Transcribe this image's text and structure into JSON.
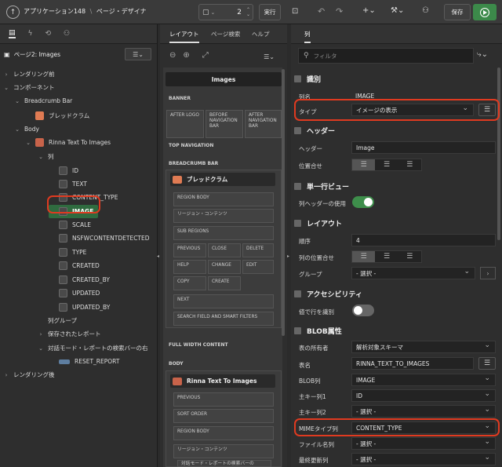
{
  "topbar": {
    "app_title": "アプリケーション148",
    "separator": "\\",
    "page_title": "ページ・デザイナ",
    "page_number": "2",
    "run_label": "実行",
    "save_label": "保存"
  },
  "left": {
    "root_label": "ページ2: Images",
    "tree": [
      {
        "label": "レンダリング前",
        "depth": 0,
        "chev": "›",
        "icon": "none"
      },
      {
        "label": "コンポーネント",
        "depth": 0,
        "chev": "⌄",
        "icon": "none"
      },
      {
        "label": "Breadcrumb Bar",
        "depth": 1,
        "chev": "⌄",
        "icon": "none"
      },
      {
        "label": "ブレッドクラム",
        "depth": 2,
        "chev": "",
        "icon": "breadcrumb"
      },
      {
        "label": "Body",
        "depth": 1,
        "chev": "⌄",
        "icon": "none"
      },
      {
        "label": "Rinna Text To Images",
        "depth": 2,
        "chev": "⌄",
        "icon": "report"
      },
      {
        "label": "列",
        "depth": 3,
        "chev": "⌄",
        "icon": "none"
      },
      {
        "label": "ID",
        "depth": 4,
        "chev": "",
        "icon": "column"
      },
      {
        "label": "TEXT",
        "depth": 4,
        "chev": "",
        "icon": "column"
      },
      {
        "label": "CONTENT_TYPE",
        "depth": 4,
        "chev": "",
        "icon": "column"
      },
      {
        "label": "IMAGE",
        "depth": 4,
        "chev": "",
        "icon": "image"
      },
      {
        "label": "SCALE",
        "depth": 4,
        "chev": "",
        "icon": "column"
      },
      {
        "label": "NSFWCONTENTDETECTED",
        "depth": 4,
        "chev": "",
        "icon": "column"
      },
      {
        "label": "TYPE",
        "depth": 4,
        "chev": "",
        "icon": "column"
      },
      {
        "label": "CREATED",
        "depth": 4,
        "chev": "",
        "icon": "column"
      },
      {
        "label": "CREATED_BY",
        "depth": 4,
        "chev": "",
        "icon": "column"
      },
      {
        "label": "UPDATED",
        "depth": 4,
        "chev": "",
        "icon": "column"
      },
      {
        "label": "UPDATED_BY",
        "depth": 4,
        "chev": "",
        "icon": "column"
      },
      {
        "label": "列グループ",
        "depth": 3,
        "chev": "",
        "icon": "none"
      },
      {
        "label": "保存されたレポート",
        "depth": 3,
        "chev": "›",
        "icon": "none"
      },
      {
        "label": "対話モード・レポートの検索バーの右",
        "depth": 3,
        "chev": "⌄",
        "icon": "none"
      },
      {
        "label": "RESET_REPORT",
        "depth": 4,
        "chev": "",
        "icon": "button"
      },
      {
        "label": "レンダリング後",
        "depth": 0,
        "chev": "›",
        "icon": "none"
      }
    ]
  },
  "middle": {
    "tabs": [
      "レイアウト",
      "ページ検索",
      "ヘルプ"
    ],
    "page_header": "Images",
    "banner": "BANNER",
    "after_logo": "AFTER LOGO",
    "before_nav": "BEFORE NAVIGATION BAR",
    "after_nav": "AFTER NAVIGATION BAR",
    "top_navigation": "TOP NAVIGATION",
    "breadcrumb_bar": "BREADCRUMB BAR",
    "breadcrumb_region": "ブレッドクラム",
    "slots": [
      "REGION BODY",
      "リージョン・コンテンツ",
      "SUB REGIONS"
    ],
    "buttons": [
      "PREVIOUS",
      "CLOSE",
      "DELETE",
      "HELP",
      "CHANGE",
      "EDIT",
      "COPY",
      "CREATE"
    ],
    "next": "NEXT",
    "search_field": "SEARCH FIELD AND SMART FILTERS",
    "full_width": "FULL WIDTH CONTENT",
    "body": "BODY",
    "report_region": "Rinna Text To Images",
    "body_slots": [
      "PREVIOUS",
      "SORT ORDER",
      "REGION BODY",
      "リージョン・コンテンツ",
      "対話モード・レポートの検索バーの"
    ]
  },
  "right": {
    "tab": "列",
    "filter_placeholder": "フィルタ",
    "sec_identify": "識別",
    "column_name_label": "列名",
    "column_name": "IMAGE",
    "type_label": "タイプ",
    "type_value": "イメージの表示",
    "sec_heading": "ヘッダー",
    "heading_label": "ヘッダー",
    "heading_value": "Image",
    "alignment_label": "位置合せ",
    "sec_single_row": "単一行ビュー",
    "use_column_heading": "列ヘッダーの使用",
    "sec_layout": "レイアウト",
    "sequence_label": "順序",
    "sequence_value": "4",
    "column_alignment_label": "列の位置合せ",
    "group_label": "グループ",
    "group_value": "- 選択 -",
    "sec_accessibility": "アクセシビリティ",
    "value_identifies_row": "値で行を識別",
    "sec_blob": "BLOB属性",
    "table_owner_label": "表の所有者",
    "table_owner_value": "解析対象スキーマ",
    "table_name_label": "表名",
    "table_name_value": "RINNA_TEXT_TO_IMAGES",
    "blob_column_label": "BLOB列",
    "blob_column_value": "IMAGE",
    "pk1_label": "主キー列1",
    "pk1_value": "ID",
    "pk2_label": "主キー列2",
    "pk2_value": "- 選択 -",
    "mime_label": "MIMEタイプ列",
    "mime_value": "CONTENT_TYPE",
    "filename_label": "ファイル名列",
    "filename_value": "- 選択 -",
    "last_updated_label": "最終更新列",
    "last_updated_value": "- 選択 -"
  },
  "colors": {
    "highlight": "#e03a20",
    "selected_item": "#2f6b3f",
    "toggle_on": "#3e8e4b",
    "run_button": "#3c8a4a"
  }
}
